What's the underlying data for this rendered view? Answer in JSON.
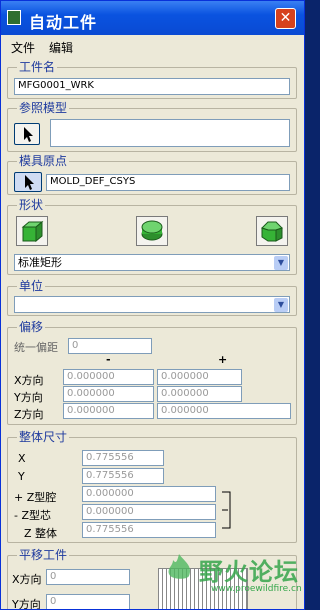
{
  "window": {
    "title": "自动工件",
    "close_glyph": "✕"
  },
  "menu": {
    "items": [
      "文件",
      "编辑"
    ]
  },
  "workpiece_name": {
    "legend": "工件名",
    "value": "MFG0001_WRK"
  },
  "reference_model": {
    "legend": "参照模型",
    "value": ""
  },
  "mold_origin": {
    "legend": "模具原点",
    "value": "MOLD_DEF_CSYS"
  },
  "shape": {
    "legend": "形状",
    "selected": "标准矩形"
  },
  "units": {
    "legend": "单位",
    "selected": ""
  },
  "offset": {
    "legend": "偏移",
    "uniform_label": "统一偏距",
    "uniform_value": "0",
    "minus_header": "-",
    "plus_header": "+",
    "rows": [
      {
        "label": "X方向",
        "minus": "0.000000",
        "plus": "0.000000"
      },
      {
        "label": "Y方向",
        "minus": "0.000000",
        "plus": "0.000000"
      },
      {
        "label": "Z方向",
        "minus": "0.000000",
        "plus": "0.000000"
      }
    ]
  },
  "overall_size": {
    "legend": "整体尺寸",
    "rows": [
      {
        "label": "X",
        "value": "0.775556"
      },
      {
        "label": "Y",
        "value": "0.775556"
      },
      {
        "label": "+ Z型腔",
        "value": "0.000000"
      },
      {
        "label": "- Z型芯",
        "value": "0.000000"
      },
      {
        "label": "Z 整体",
        "value": "0.775556"
      }
    ]
  },
  "translate": {
    "legend": "平移工件",
    "rows": [
      {
        "label": "X方向",
        "value": "0"
      },
      {
        "label": "Y方向",
        "value": "0"
      }
    ]
  },
  "watermark": {
    "text": "野火论坛",
    "url": "www.proewildfire.cn"
  }
}
